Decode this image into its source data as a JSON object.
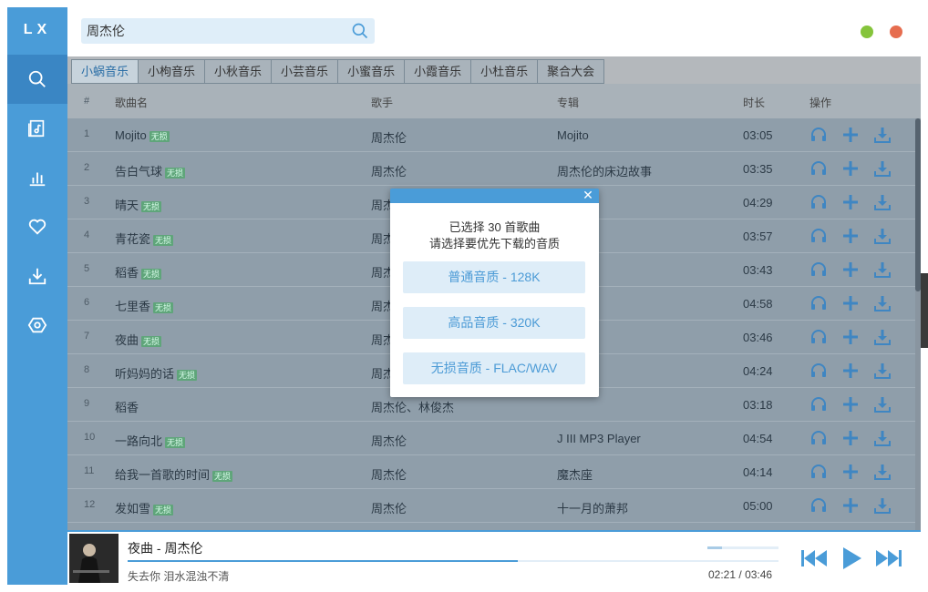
{
  "app": {
    "logo": "LX"
  },
  "colors": {
    "accent": "#4a9cd8",
    "minimize": "#85c43b",
    "close": "#e66d4f",
    "badge": "#5fa57a"
  },
  "sidebar": {
    "items": [
      {
        "name": "search",
        "icon": "search-icon"
      },
      {
        "name": "songlist",
        "icon": "music-file-icon"
      },
      {
        "name": "leaderboard",
        "icon": "bar-chart-icon"
      },
      {
        "name": "favorites",
        "icon": "heart-icon"
      },
      {
        "name": "download",
        "icon": "download-icon"
      },
      {
        "name": "settings",
        "icon": "hexagon-settings-icon"
      }
    ]
  },
  "search": {
    "value": "周杰伦"
  },
  "tabs": [
    "小蜗音乐",
    "小枸音乐",
    "小秋音乐",
    "小芸音乐",
    "小蜜音乐",
    "小霞音乐",
    "小杜音乐",
    "聚合大会"
  ],
  "table": {
    "headers": {
      "num": "#",
      "name": "歌曲名",
      "artist": "歌手",
      "album": "专辑",
      "duration": "时长",
      "ops": "操作"
    },
    "badge_label": "无损",
    "rows": [
      {
        "num": "1",
        "name": "Mojito",
        "badge": true,
        "artist": "周杰伦",
        "album": "Mojito",
        "duration": "03:05"
      },
      {
        "num": "2",
        "name": "告白气球",
        "badge": true,
        "artist": "周杰伦",
        "album": "周杰伦的床边故事",
        "duration": "03:35"
      },
      {
        "num": "3",
        "name": "晴天",
        "badge": true,
        "artist": "周杰伦",
        "album": "",
        "duration": "04:29"
      },
      {
        "num": "4",
        "name": "青花瓷",
        "badge": true,
        "artist": "周杰伦",
        "album": "",
        "duration": "03:57"
      },
      {
        "num": "5",
        "name": "稻香",
        "badge": true,
        "artist": "周杰伦",
        "album": "",
        "duration": "03:43"
      },
      {
        "num": "6",
        "name": "七里香",
        "badge": true,
        "artist": "周杰伦",
        "album": "",
        "duration": "04:58"
      },
      {
        "num": "7",
        "name": "夜曲",
        "badge": true,
        "artist": "周杰伦",
        "album": "的萧邦",
        "duration": "03:46"
      },
      {
        "num": "8",
        "name": "听妈妈的话",
        "badge": true,
        "artist": "周杰伦",
        "album": "西",
        "duration": "04:24"
      },
      {
        "num": "9",
        "name": "稻香",
        "badge": false,
        "artist": "周杰伦、林俊杰",
        "album": "",
        "duration": "03:18"
      },
      {
        "num": "10",
        "name": "一路向北",
        "badge": true,
        "artist": "周杰伦",
        "album": "J III MP3 Player",
        "duration": "04:54"
      },
      {
        "num": "11",
        "name": "给我一首歌的时间",
        "badge": true,
        "artist": "周杰伦",
        "album": "魔杰座",
        "duration": "04:14"
      },
      {
        "num": "12",
        "name": "发如雪",
        "badge": true,
        "artist": "周杰伦",
        "album": "十一月的萧邦",
        "duration": "05:00"
      }
    ]
  },
  "player": {
    "title": "夜曲 - 周杰伦",
    "lyric": "失去你 泪水混浊不清",
    "current_time": "02:21",
    "separator": "/",
    "total_time": "03:46",
    "progress": 0.6,
    "volume": 0.2
  },
  "modal": {
    "line1": "已选择 30 首歌曲",
    "line2": "请选择要优先下载的音质",
    "close": "✕",
    "options": [
      "普通音质 - 128K",
      "高品音质 - 320K",
      "无损音质 - FLAC/WAV"
    ]
  }
}
